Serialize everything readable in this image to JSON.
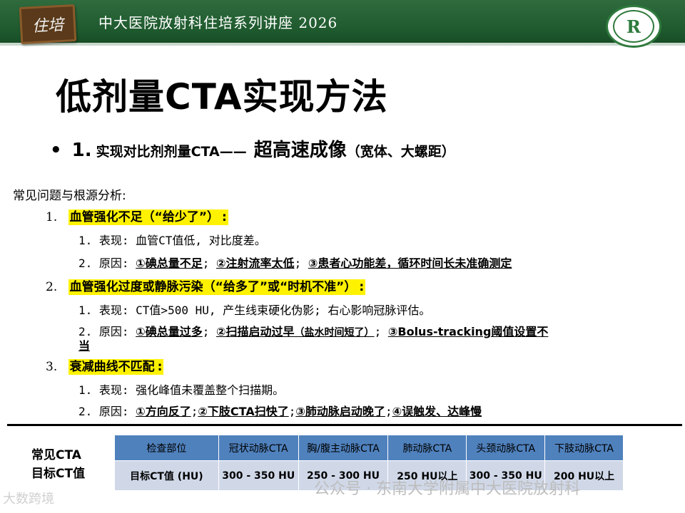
{
  "header": {
    "logo_text": "住培",
    "title": "中大医院放射科住培系列讲座  2026",
    "emblem_letter": "R"
  },
  "title": "低剂量CTA实现方法",
  "subtitle": {
    "bullet": "•",
    "num": "1.",
    "text": "实现对比剂剂量CTA——",
    "emphasis": "超高速成像",
    "paren": "（宽体、大螺距）"
  },
  "section_label": "常见问题与根源分析:",
  "items": [
    {
      "num": "1.",
      "title": "血管强化不足（“给少了”）",
      "colon": ":"
    },
    {
      "num": "2.",
      "title": "血管强化过度或静脉污染（“给多了”或“时机不准”）",
      "colon": ":"
    },
    {
      "num": "3.",
      "title": "衰减曲线不匹配",
      "colon": ":"
    }
  ],
  "item1_sub": {
    "line1": "1. 表现: 血管CT值低, 对比度差。",
    "l2_prefix": "2. 原因: ",
    "l2_a": "①碘总量不足",
    "l2_sep1": "; ",
    "l2_b": "②注射流率太低",
    "l2_sep2": "; ",
    "l2_c": "③患者心功能差，循环时间长未准确测定"
  },
  "item2_sub": {
    "line1": "1. 表现: CT值>500 HU, 产生线束硬化伪影; 右心影响冠脉评估。",
    "l2_prefix": "2. 原因: ",
    "l2_a": "①碘总量过多",
    "l2_sep1": "; ",
    "l2_b": "②扫描启动过早",
    "l2_b_small": "（盐水时间短了）",
    "l2_sep2": "; ",
    "l2_c": "③Bolus-tracking阈值设置不",
    "l2_c2": "当"
  },
  "item3_sub": {
    "line1": "1. 表现: 强化峰值未覆盖整个扫描期。",
    "l2_prefix": "2. 原因: ",
    "l2_a": "①方向反了",
    "l2_sep1": ";",
    "l2_b": "②下肢CTA扫快了",
    "l2_sep2": ";",
    "l2_c": "③肺动脉启动晚了",
    "l2_sep3": ";",
    "l2_d": "④误触发、达峰慢"
  },
  "table_label": {
    "line1": "常见CTA",
    "line2": "目标CT值"
  },
  "table": {
    "headers": [
      "检查部位",
      "冠状动脉CTA",
      "胸/腹主动脉CTA",
      "肺动脉CTA",
      "头颈动脉CTA",
      "下肢动脉CTA"
    ],
    "row": [
      "目标CT值 (HU)",
      "300 - 350 HU",
      "250 - 300 HU",
      "250 HU以上",
      "300 - 350 HU",
      "200 HU以上"
    ]
  },
  "watermarks": {
    "left": "大数跨境",
    "right": "公众号 · 东南大学附属中大医院放射科"
  }
}
